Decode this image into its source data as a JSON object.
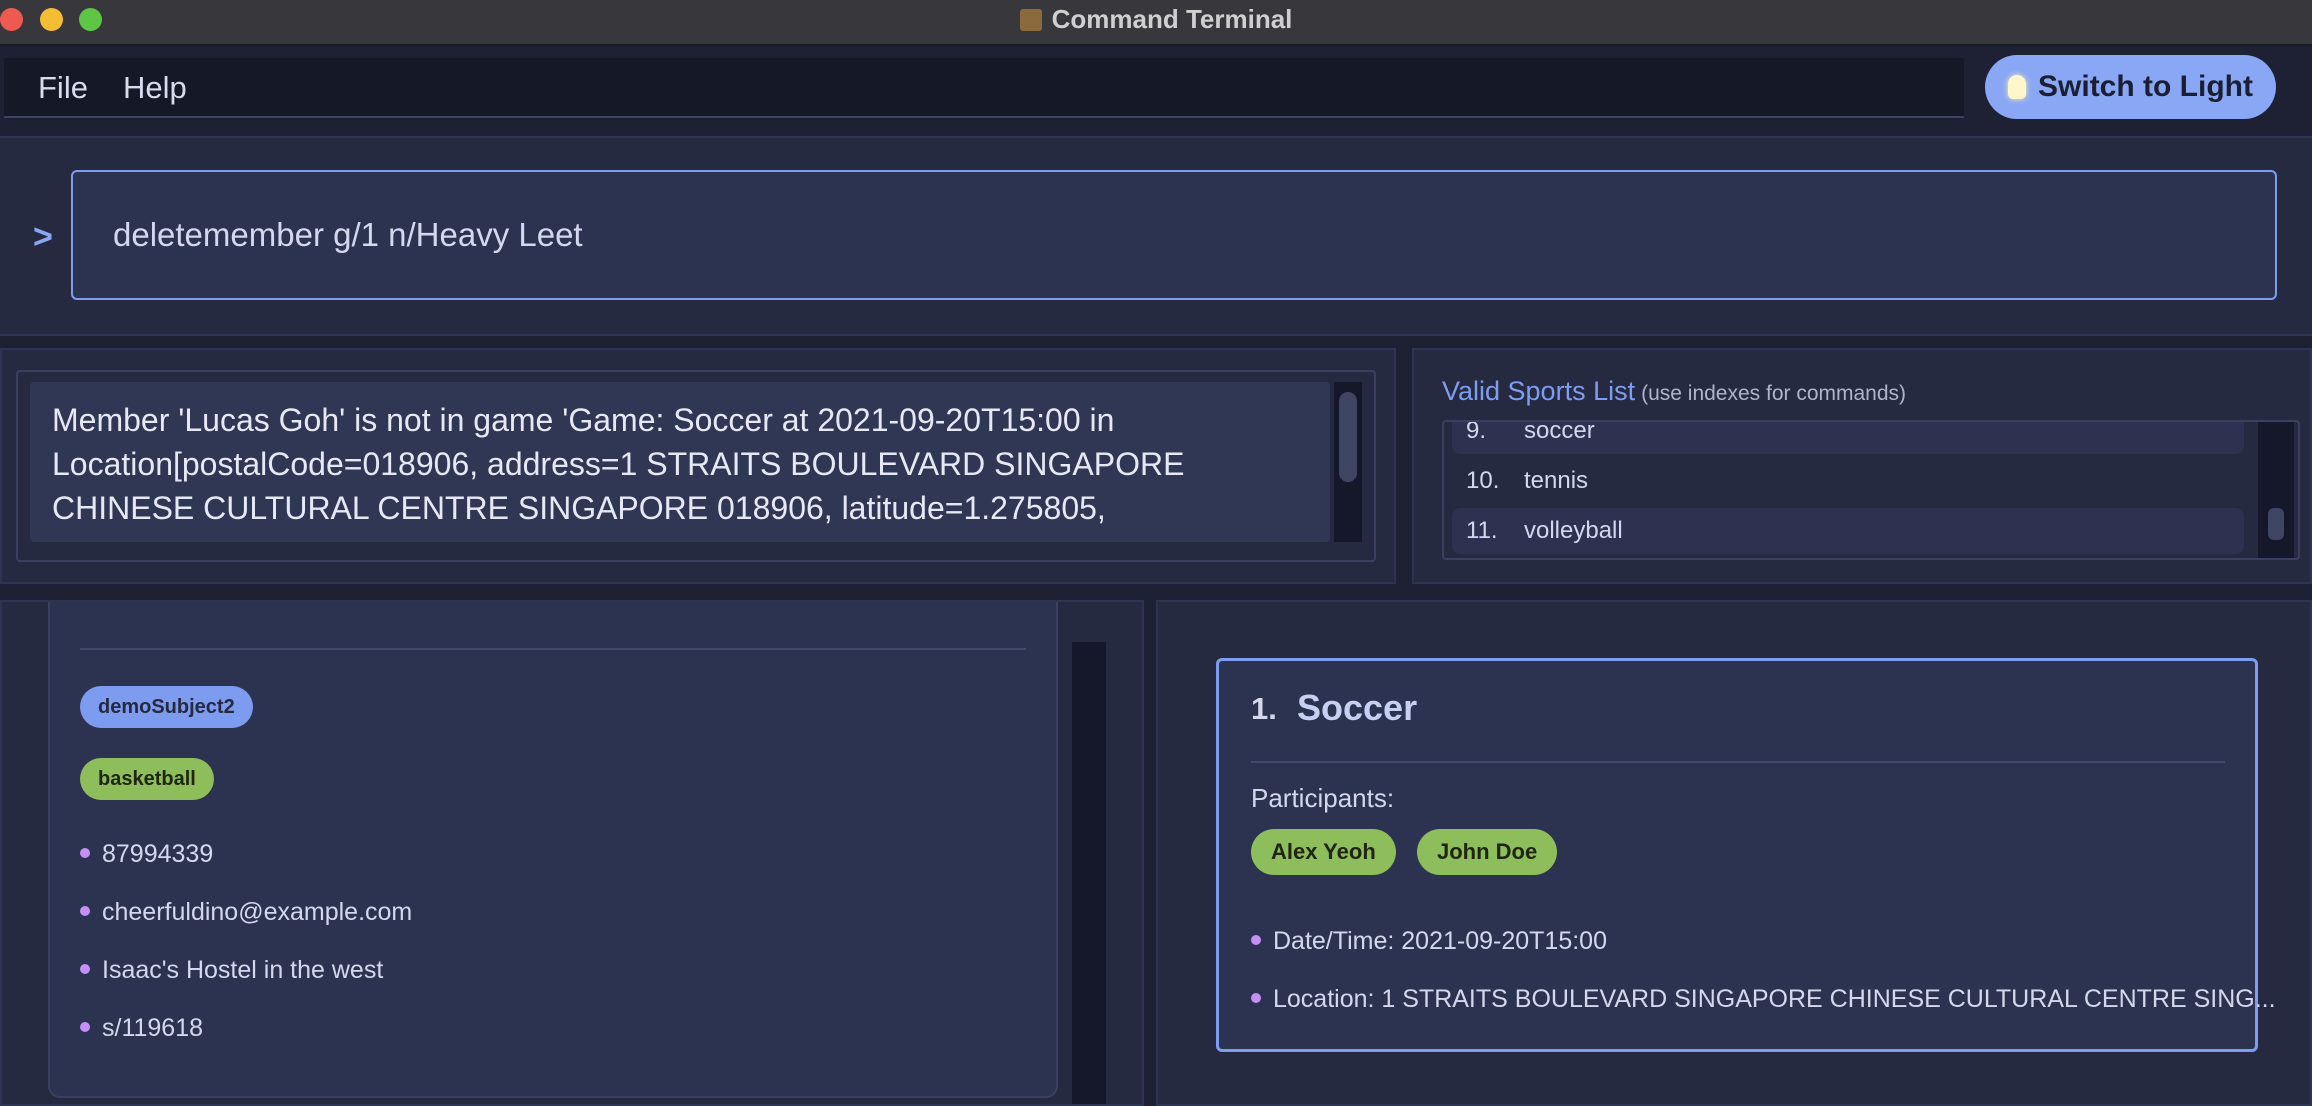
{
  "window": {
    "title": "Command Terminal"
  },
  "menu": {
    "file": "File",
    "help": "Help"
  },
  "theme_button": {
    "label": "Switch to Light"
  },
  "command": {
    "prompt": ">",
    "value": "deletemember g/1 n/Heavy Leet"
  },
  "result": {
    "text": "Member 'Lucas Goh' is not in game 'Game: Soccer at 2021-09-20T15:00 in Location[postalCode=018906, address=1 STRAITS BOULEVARD SINGAPORE CHINESE CULTURAL CENTRE SINGAPORE 018906, latitude=1.275805,"
  },
  "sports": {
    "title": "Valid Sports List",
    "hint": "(use indexes for commands)",
    "items": [
      {
        "index": "9.",
        "name": "soccer"
      },
      {
        "index": "10.",
        "name": "tennis"
      },
      {
        "index": "11.",
        "name": "volleyball"
      }
    ]
  },
  "member": {
    "tags": [
      "demoSubject2",
      "basketball"
    ],
    "phone": "87994339",
    "email": "cheerfuldino@example.com",
    "address": "Isaac's Hostel in the west",
    "postal": "s/119618"
  },
  "game": {
    "index": "1.",
    "name": "Soccer",
    "participants_label": "Participants:",
    "participants": [
      "Alex Yeoh",
      "John Doe"
    ],
    "datetime": "Date/Time: 2021-09-20T15:00",
    "location": "Location: 1 STRAITS BOULEVARD SINGAPORE CHINESE CULTURAL CENTRE SING..."
  },
  "colors": {
    "accent": "#7f9df0",
    "tag_blue": "#7d9cef",
    "tag_green": "#8ebd5c",
    "bullet": "#c590f5"
  }
}
